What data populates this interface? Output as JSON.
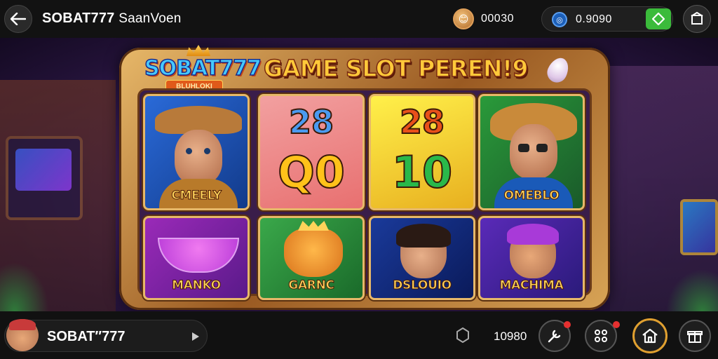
{
  "topbar": {
    "title": "SOBAT777",
    "subtitle": "SaanVoen",
    "coin_value": "00030",
    "balance_value": "0.9090"
  },
  "banner": {
    "logo_text": "SOBAT777",
    "logo_tag": "BLUHLOKI",
    "headline": "GAME SLOT PEREN!9"
  },
  "tiles": [
    {
      "label": "CMEELY"
    },
    {
      "num_top": "28",
      "num_bottom": "Q0"
    },
    {
      "num_top": "28",
      "num_bottom": "10"
    },
    {
      "label": "OMEBLO"
    },
    {
      "label": "MANKO"
    },
    {
      "label": "GARNC"
    },
    {
      "label": "DSLOUIO"
    },
    {
      "label": "MACHIMA"
    }
  ],
  "bottombar": {
    "username": "SOBAT″777",
    "value": "10980"
  },
  "colors": {
    "accent_green": "#3bbb3b",
    "gold": "#e7b869",
    "notify_red": "#e53030",
    "home_ring": "#e0a030"
  }
}
